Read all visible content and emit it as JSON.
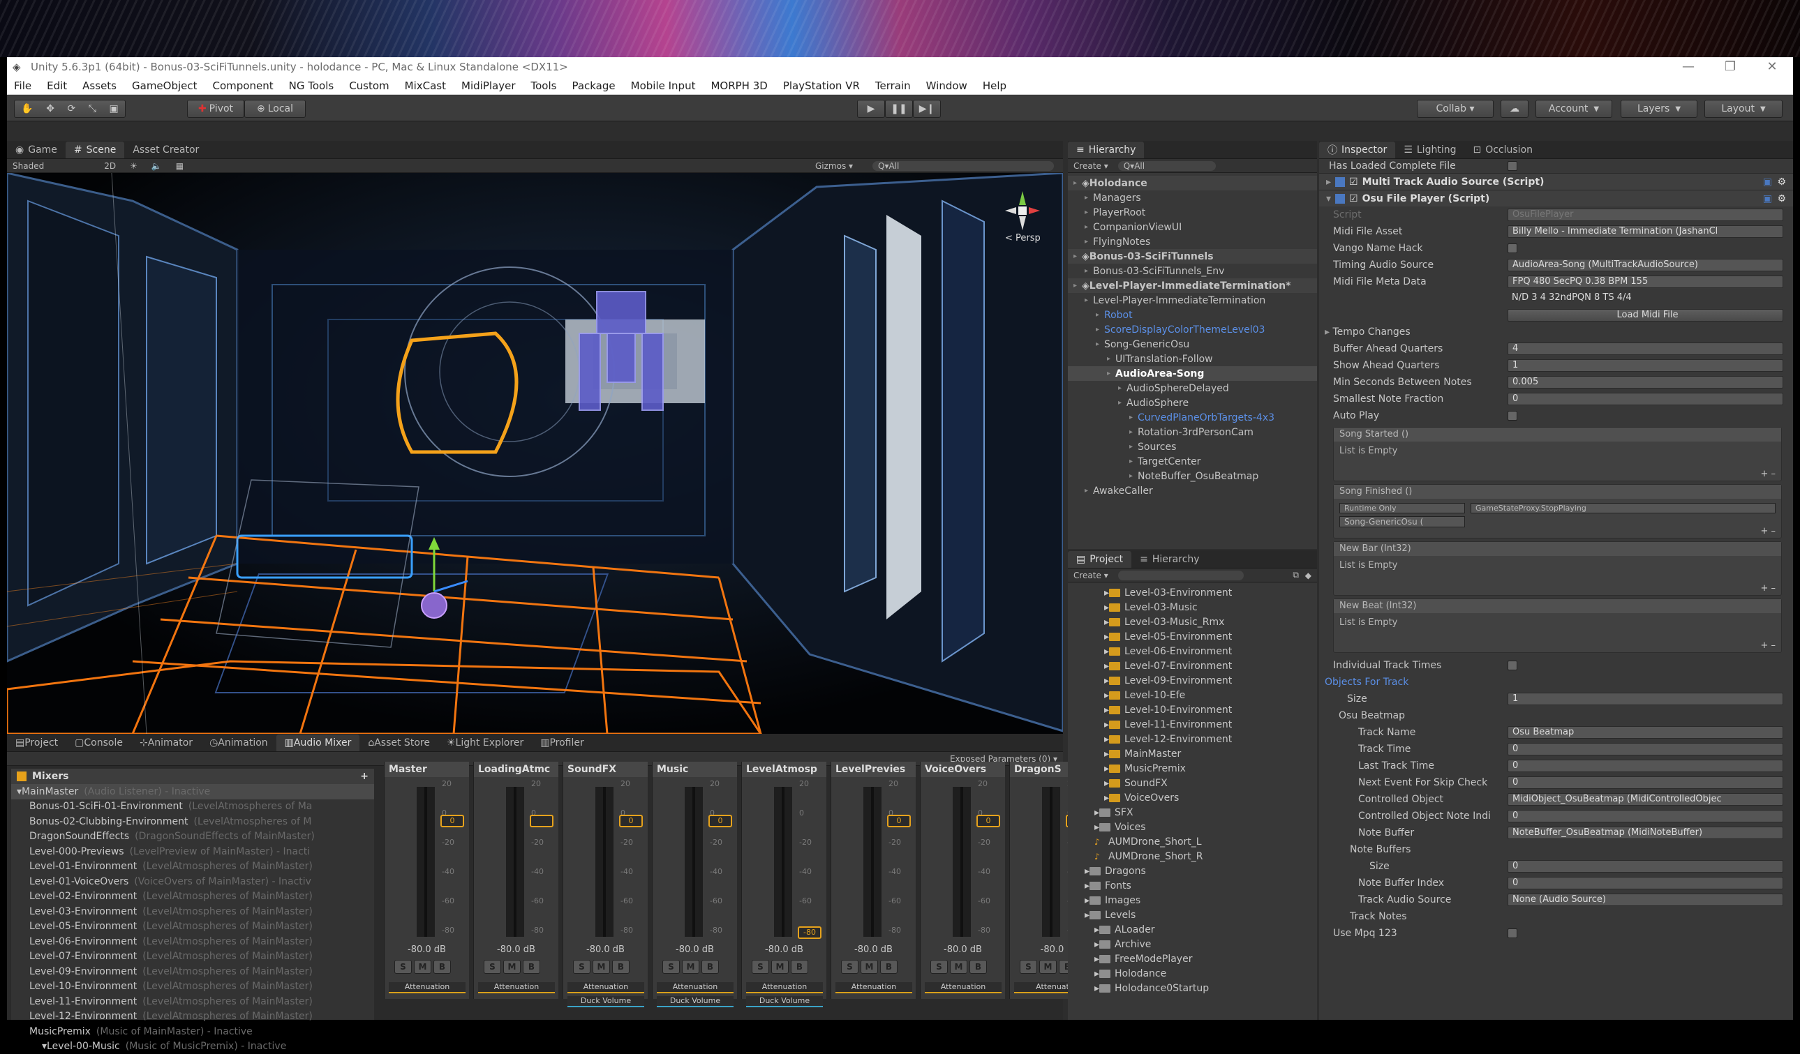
{
  "window": {
    "title": "Unity 5.6.3p1 (64bit) - Bonus-03-SciFiTunnels.unity - holodance - PC, Mac & Linux Standalone <DX11>",
    "controls": [
      "—",
      "❐",
      "✕"
    ]
  },
  "menu": [
    "File",
    "Edit",
    "Assets",
    "GameObject",
    "Component",
    "NG Tools",
    "Custom",
    "MixCast",
    "MidiPlayer",
    "Tools",
    "Package",
    "Mobile Input",
    "MORPH 3D",
    "PlayStation VR",
    "Terrain",
    "Window",
    "Help"
  ],
  "toolbar": {
    "pivot": "Pivot",
    "local": "Local",
    "collab": "Collab ▾",
    "account": "Account",
    "layers": "Layers",
    "layout": "Layout"
  },
  "scene": {
    "tabs": [
      "Game",
      "Scene",
      "Asset Creator"
    ],
    "shading": "Shaded",
    "mode2d": "2D",
    "gizmos": "Gizmos ▾",
    "search": "Q▾All",
    "persp": "< Persp"
  },
  "hierarchy": {
    "tab": "Hierarchy",
    "create": "Create ▾",
    "search": "Q▾All",
    "rows": [
      {
        "t": "Holodance",
        "d": 0,
        "k": "scene"
      },
      {
        "t": "Managers",
        "d": 1
      },
      {
        "t": "PlayerRoot",
        "d": 1
      },
      {
        "t": "CompanionViewUI",
        "d": 1
      },
      {
        "t": "FlyingNotes",
        "d": 1
      },
      {
        "t": "Bonus-03-SciFiTunnels",
        "d": 0,
        "k": "scene"
      },
      {
        "t": "Bonus-03-SciFiTunnels_Env",
        "d": 1
      },
      {
        "t": "Level-Player-ImmediateTermination*",
        "d": 0,
        "k": "scene2"
      },
      {
        "t": "Level-Player-ImmediateTermination",
        "d": 1
      },
      {
        "t": "Robot",
        "d": 2,
        "k": "blue"
      },
      {
        "t": "ScoreDisplayColorThemeLevel03",
        "d": 2,
        "k": "blue"
      },
      {
        "t": "Song-GenericOsu",
        "d": 2
      },
      {
        "t": "UITranslation-Follow",
        "d": 3
      },
      {
        "t": "AudioArea-Song",
        "d": 3,
        "k": "sel"
      },
      {
        "t": "AudioSphereDelayed",
        "d": 4
      },
      {
        "t": "AudioSphere",
        "d": 4
      },
      {
        "t": "CurvedPlaneOrbTargets-4x3",
        "d": 5,
        "k": "blue"
      },
      {
        "t": "Rotation-3rdPersonCam",
        "d": 5
      },
      {
        "t": "Sources",
        "d": 5
      },
      {
        "t": "TargetCenter",
        "d": 5
      },
      {
        "t": "NoteBuffer_OsuBeatmap",
        "d": 5
      },
      {
        "t": "AwakeCaller",
        "d": 1
      }
    ]
  },
  "project": {
    "tabs": [
      "Project",
      "Hierarchy"
    ],
    "create": "Create ▾",
    "rows": [
      {
        "t": "Level-03-Environment",
        "d": 3,
        "c": "o"
      },
      {
        "t": "Level-03-Music",
        "d": 3,
        "c": "o"
      },
      {
        "t": "Level-03-Music_Rmx",
        "d": 3,
        "c": "o"
      },
      {
        "t": "Level-05-Environment",
        "d": 3,
        "c": "o"
      },
      {
        "t": "Level-06-Environment",
        "d": 3,
        "c": "o"
      },
      {
        "t": "Level-07-Environment",
        "d": 3,
        "c": "o"
      },
      {
        "t": "Level-09-Environment",
        "d": 3,
        "c": "o"
      },
      {
        "t": "Level-10-Efe",
        "d": 3,
        "c": "o"
      },
      {
        "t": "Level-10-Environment",
        "d": 3,
        "c": "o"
      },
      {
        "t": "Level-11-Environment",
        "d": 3,
        "c": "o"
      },
      {
        "t": "Level-12-Environment",
        "d": 3,
        "c": "o"
      },
      {
        "t": "MainMaster",
        "d": 3,
        "c": "o"
      },
      {
        "t": "MusicPremix",
        "d": 3,
        "c": "o"
      },
      {
        "t": "SoundFX",
        "d": 3,
        "c": "o"
      },
      {
        "t": "VoiceOvers",
        "d": 3,
        "c": "o"
      },
      {
        "t": "SFX",
        "d": 2,
        "c": "g"
      },
      {
        "t": "Voices",
        "d": 2,
        "c": "g"
      },
      {
        "t": "AUMDrone_Short_L",
        "d": 2,
        "c": "a"
      },
      {
        "t": "AUMDrone_Short_R",
        "d": 2,
        "c": "a"
      },
      {
        "t": "Dragons",
        "d": 1,
        "c": "g"
      },
      {
        "t": "Fonts",
        "d": 1,
        "c": "g"
      },
      {
        "t": "Images",
        "d": 1,
        "c": "g"
      },
      {
        "t": "Levels",
        "d": 1,
        "c": "g"
      },
      {
        "t": "ALoader",
        "d": 2,
        "c": "g"
      },
      {
        "t": "Archive",
        "d": 2,
        "c": "g"
      },
      {
        "t": "FreeModePlayer",
        "d": 2,
        "c": "g"
      },
      {
        "t": "Holodance",
        "d": 2,
        "c": "g"
      },
      {
        "t": "Holodance0Startup",
        "d": 2,
        "c": "g"
      }
    ]
  },
  "bottom": {
    "tabs": [
      "Project",
      "Console",
      "Animator",
      "Animation",
      "Audio Mixer",
      "Asset Store",
      "Light Explorer",
      "Profiler"
    ],
    "exposed": "Exposed Parameters (0) ▾",
    "mixers_label": "Mixers",
    "plus": "+",
    "mixer_rows": [
      {
        "n": "MainMaster",
        "s": "(Audio Listener) - Inactive",
        "d": 0
      },
      {
        "n": "Bonus-01-SciFi-01-Environment",
        "s": "(LevelAtmospheres of Ma",
        "d": 1
      },
      {
        "n": "Bonus-02-Clubbing-Environment",
        "s": "(LevelAtmospheres of M",
        "d": 1
      },
      {
        "n": "DragonSoundEffects",
        "s": "(DragonSoundEffects of MainMaster)",
        "d": 1
      },
      {
        "n": "Level-000-Previews",
        "s": "(LevelPreview of MainMaster) - Inacti",
        "d": 1
      },
      {
        "n": "Level-01-Environment",
        "s": "(LevelAtmospheres of MainMaster)",
        "d": 1
      },
      {
        "n": "Level-01-VoiceOvers",
        "s": "(VoiceOvers of MainMaster) - Inactiv",
        "d": 1
      },
      {
        "n": "Level-02-Environment",
        "s": "(LevelAtmospheres of MainMaster)",
        "d": 1
      },
      {
        "n": "Level-03-Environment",
        "s": "(LevelAtmospheres of MainMaster)",
        "d": 1
      },
      {
        "n": "Level-05-Environment",
        "s": "(LevelAtmospheres of MainMaster)",
        "d": 1
      },
      {
        "n": "Level-06-Environment",
        "s": "(LevelAtmospheres of MainMaster)",
        "d": 1
      },
      {
        "n": "Level-07-Environment",
        "s": "(LevelAtmospheres of MainMaster)",
        "d": 1
      },
      {
        "n": "Level-09-Environment",
        "s": "(LevelAtmospheres of MainMaster)",
        "d": 1
      },
      {
        "n": "Level-10-Environment",
        "s": "(LevelAtmospheres of MainMaster)",
        "d": 1
      },
      {
        "n": "Level-11-Environment",
        "s": "(LevelAtmospheres of MainMaster)",
        "d": 1
      },
      {
        "n": "Level-12-Environment",
        "s": "(LevelAtmospheres of MainMaster)",
        "d": 1
      },
      {
        "n": "MusicPremix",
        "s": "(Music of MainMaster) - Inactive",
        "d": 1
      },
      {
        "n": "Level-00-Music",
        "s": "(Music of MusicPremix) - Inactive",
        "d": 2
      }
    ],
    "scale": [
      "20",
      "0",
      "-20",
      "-40",
      "-60",
      "-80"
    ],
    "strips": [
      {
        "n": "Master",
        "db": "-80.0 dB",
        "f": "0",
        "fy": 0,
        "e": [
          "Attenuation"
        ]
      },
      {
        "n": "LoadingAtmc",
        "db": "-80.0 dB",
        "f": "",
        "fy": 0,
        "e": [
          "Attenuation"
        ]
      },
      {
        "n": "SoundFX",
        "db": "-80.0 dB",
        "f": "0",
        "fy": 0,
        "e": [
          "Attenuation",
          "Duck Volume"
        ]
      },
      {
        "n": "Music",
        "db": "-80.0 dB",
        "f": "0",
        "fy": 0,
        "e": [
          "Attenuation",
          "Duck Volume"
        ]
      },
      {
        "n": "LevelAtmosp",
        "db": "-80.0 dB",
        "f": "-80",
        "fy": 1,
        "e": [
          "Attenuation",
          "Duck Volume"
        ]
      },
      {
        "n": "LevelPrevies",
        "db": "-80.0 dB",
        "f": "0",
        "fy": 0,
        "e": [
          "Attenuation"
        ]
      },
      {
        "n": "VoiceOvers",
        "db": "-80.0 dB",
        "f": "0",
        "fy": 0,
        "e": [
          "Attenuation"
        ]
      },
      {
        "n": "DragonS",
        "db": "-80.0",
        "f": "",
        "fy": 0,
        "e": [
          "Attenuat"
        ]
      }
    ],
    "smb": [
      "S",
      "M",
      "B"
    ]
  },
  "inspector": {
    "tabs": [
      "Inspector",
      "Lighting",
      "Occlusion"
    ],
    "has_loaded": "Has Loaded Complete File",
    "comp1": "Multi Track Audio Source (Script)",
    "comp2": "Osu File Player (Script)",
    "fields": [
      {
        "l": "Script",
        "v": "OsuFilePlayer",
        "dim": true
      },
      {
        "l": "Midi File Asset",
        "v": "Billy Mello - Immediate Termination (JashanCl"
      },
      {
        "l": "Vango Name Hack",
        "chk": true
      },
      {
        "l": "Timing Audio Source",
        "v": "AudioArea-Song (MultiTrackAudioSource)"
      },
      {
        "l": "Midi File Meta Data",
        "v": "FPQ  480    SecPQ      0.38   BPM   155"
      }
    ],
    "meta2": "N/D   3   4     32ndPQN   8         TS      4/4",
    "load_btn": "Load Midi File",
    "fields2": [
      {
        "l": "Buffer Ahead Quarters",
        "v": "4"
      },
      {
        "l": "Show Ahead Quarters",
        "v": "1"
      },
      {
        "l": "Min Seconds Between Notes",
        "v": "0.005"
      },
      {
        "l": "Smallest Note Fraction",
        "v": "0"
      },
      {
        "l": "Auto Play",
        "chk": true
      }
    ],
    "tempo": "Tempo Changes",
    "events": [
      {
        "h": "Song Started ()",
        "b": "List is Empty"
      },
      {
        "h": "Song Finished ()",
        "runtime": "Runtime Only",
        "fn": "GameStateProxy.StopPlaying",
        "obj": "Song-GenericOsu ("
      },
      {
        "h": "New Bar (Int32)",
        "b": "List is Empty"
      },
      {
        "h": "New Beat (Int32)",
        "b": "List is Empty"
      }
    ],
    "fields3": [
      {
        "l": "Individual Track Times",
        "chk": true,
        "x": 20
      },
      {
        "l": "Objects For Track",
        "blue": true,
        "x": 8
      },
      {
        "l": "Size",
        "v": "1",
        "x": 40
      },
      {
        "l": "Osu Beatmap",
        "x": 28
      },
      {
        "l": "Track Name",
        "v": "Osu Beatmap",
        "x": 56
      },
      {
        "l": "Track Time",
        "v": "0",
        "x": 56
      },
      {
        "l": "Last Track Time",
        "v": "0",
        "x": 56
      },
      {
        "l": "Next Event For Skip Check",
        "v": "0",
        "x": 56
      },
      {
        "l": "Controlled Object",
        "v": "MidiObject_OsuBeatmap (MidiControlledObjec",
        "x": 56
      },
      {
        "l": "Controlled Object Note Indi",
        "v": "0",
        "x": 56
      },
      {
        "l": "Note Buffer",
        "v": "NoteBuffer_OsuBeatmap (MidiNoteBuffer)",
        "x": 56
      },
      {
        "l": "Note Buffers",
        "x": 44
      },
      {
        "l": "Size",
        "v": "0",
        "x": 72
      },
      {
        "l": "Note Buffer Index",
        "v": "0",
        "x": 56
      },
      {
        "l": "Track Audio Source",
        "v": "None (Audio Source)",
        "x": 56
      },
      {
        "l": "Track Notes",
        "x": 44
      },
      {
        "l": "Use Mpq 123",
        "chk": true,
        "x": 20
      }
    ]
  }
}
